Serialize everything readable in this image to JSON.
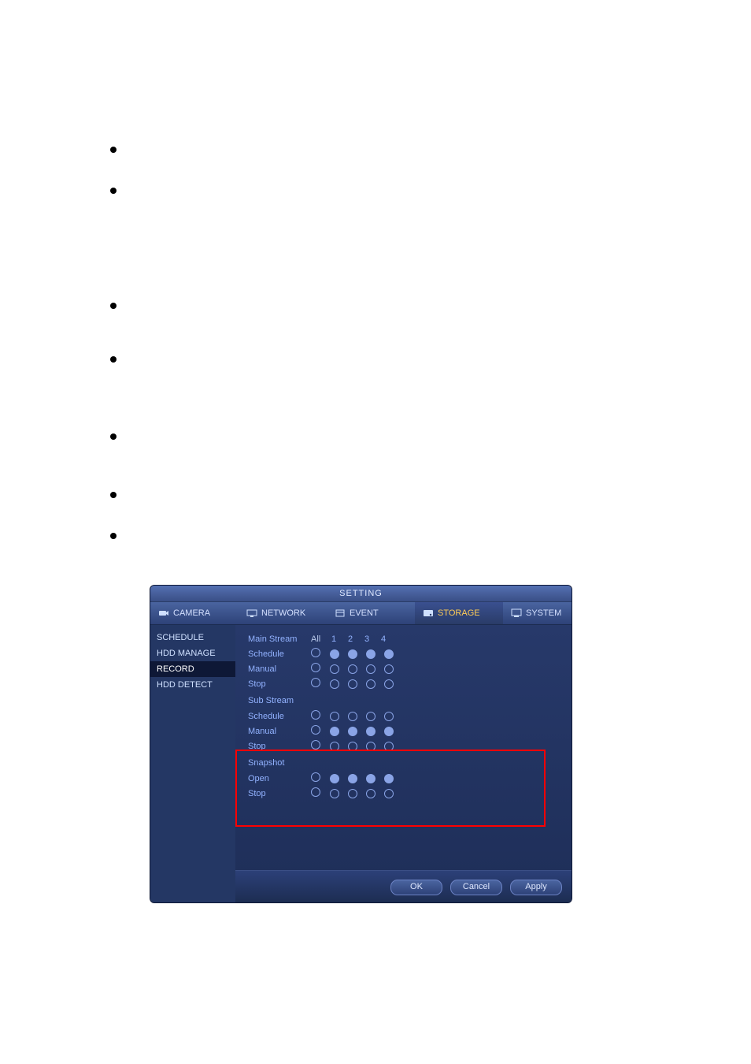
{
  "window": {
    "title": "SETTING"
  },
  "tabs": {
    "camera": {
      "label": "CAMERA"
    },
    "network": {
      "label": "NETWORK"
    },
    "event": {
      "label": "EVENT"
    },
    "storage": {
      "label": "STORAGE"
    },
    "system": {
      "label": "SYSTEM"
    }
  },
  "sidebar": {
    "schedule": {
      "label": "SCHEDULE"
    },
    "hdd_manage": {
      "label": "HDD MANAGE"
    },
    "record": {
      "label": "RECORD"
    },
    "hdd_detect": {
      "label": "HDD DETECT"
    }
  },
  "headers": {
    "main_stream": "Main Stream",
    "sub_stream": "Sub Stream",
    "snapshot": "Snapshot",
    "all": "All",
    "ch": [
      "1",
      "2",
      "3",
      "4"
    ]
  },
  "rows": {
    "main_schedule": {
      "label": "Schedule",
      "all": false,
      "ch": [
        true,
        true,
        true,
        true
      ]
    },
    "main_manual": {
      "label": "Manual",
      "all": false,
      "ch": [
        false,
        false,
        false,
        false
      ]
    },
    "main_stop": {
      "label": "Stop",
      "all": false,
      "ch": [
        false,
        false,
        false,
        false
      ]
    },
    "sub_schedule": {
      "label": "Schedule",
      "all": false,
      "ch": [
        false,
        false,
        false,
        false
      ]
    },
    "sub_manual": {
      "label": "Manual",
      "all": false,
      "ch": [
        true,
        true,
        true,
        true
      ]
    },
    "sub_stop": {
      "label": "Stop",
      "all": false,
      "ch": [
        false,
        false,
        false,
        false
      ]
    },
    "snap_open": {
      "label": "Open",
      "all": false,
      "ch": [
        true,
        true,
        true,
        true
      ]
    },
    "snap_stop": {
      "label": "Stop",
      "all": false,
      "ch": [
        false,
        false,
        false,
        false
      ]
    }
  },
  "buttons": {
    "ok": "OK",
    "cancel": "Cancel",
    "apply": "Apply"
  }
}
